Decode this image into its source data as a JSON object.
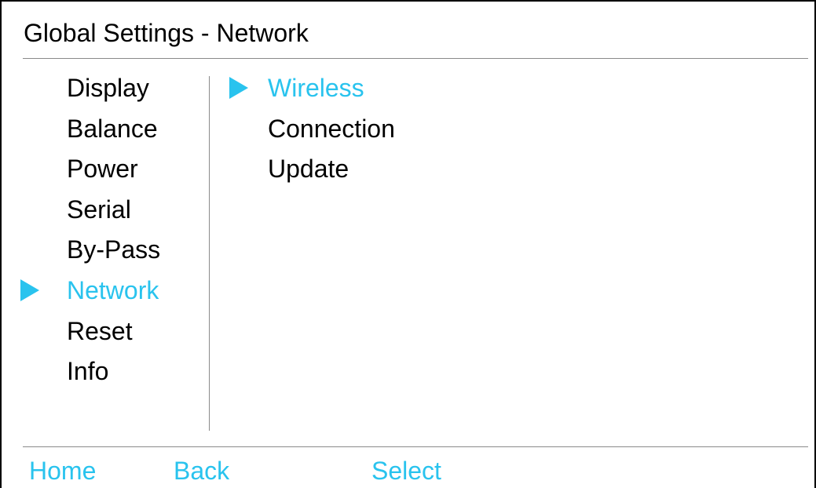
{
  "window": {
    "title": "Global Settings - Network"
  },
  "colors": {
    "accent": "#29c3ee",
    "text": "#000000",
    "divider": "#8a8a8a"
  },
  "left_menu": {
    "items": [
      {
        "label": "Display",
        "selected": false
      },
      {
        "label": "Balance",
        "selected": false
      },
      {
        "label": "Power",
        "selected": false
      },
      {
        "label": "Serial",
        "selected": false
      },
      {
        "label": "By-Pass",
        "selected": false
      },
      {
        "label": "Network",
        "selected": true
      },
      {
        "label": "Reset",
        "selected": false
      },
      {
        "label": "Info",
        "selected": false
      }
    ]
  },
  "right_menu": {
    "items": [
      {
        "label": "Wireless",
        "selected": true
      },
      {
        "label": "Connection",
        "selected": false
      },
      {
        "label": "Update",
        "selected": false
      }
    ]
  },
  "softkeys": {
    "home": "Home",
    "back": "Back",
    "select": "Select"
  },
  "icons": {
    "selection_marker": "right-triangle-icon"
  }
}
